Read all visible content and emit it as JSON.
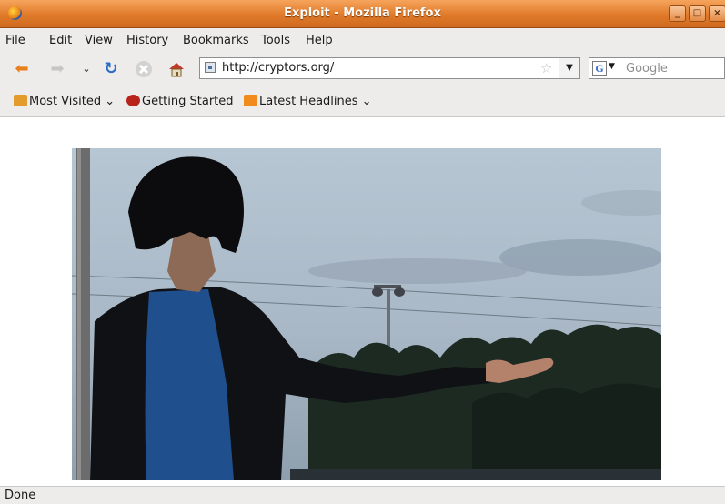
{
  "window": {
    "title": "Exploit - Mozilla Firefox"
  },
  "menu": [
    "File",
    "Edit",
    "View",
    "History",
    "Bookmarks",
    "Tools",
    "Help"
  ],
  "nav": {
    "url": "http://cryptors.org/",
    "search_engine": "Google"
  },
  "bookmarks": [
    "Most Visited",
    "Getting Started",
    "Latest Headlines"
  ],
  "status": "Done",
  "colors": {
    "titlebar": "#e07a2a",
    "chrome": "#edeceb"
  }
}
